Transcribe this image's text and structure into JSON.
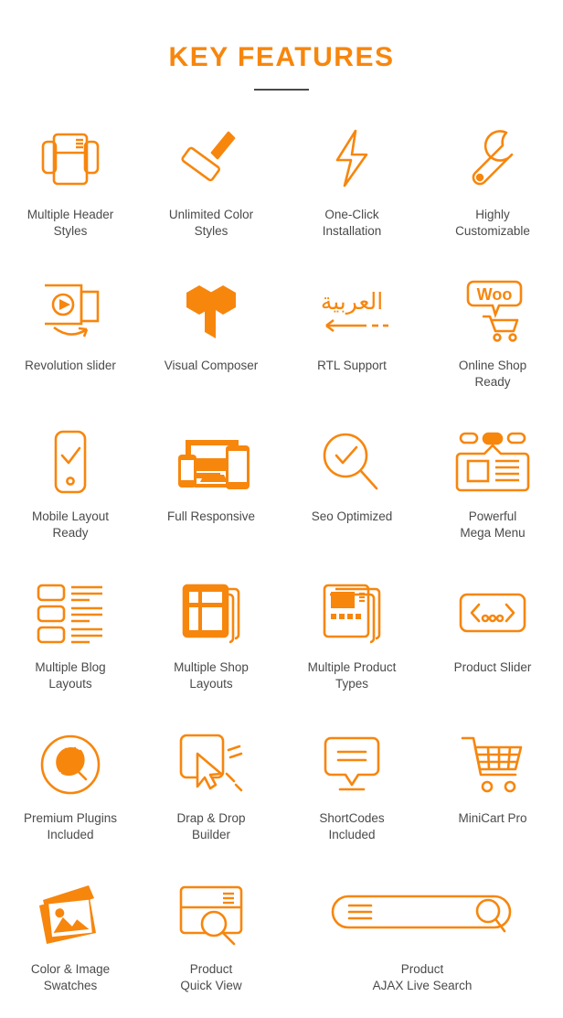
{
  "header": {
    "title": "KEY FEATURES"
  },
  "colors": {
    "accent": "#F7860D",
    "label_text": "#4a4a4a",
    "background": "#ffffff",
    "divider": "#4a4a4a"
  },
  "features": [
    {
      "icon": "multiple-header-styles-icon",
      "label": "Multiple Header\nStyles"
    },
    {
      "icon": "paint-roller-icon",
      "label": "Unlimited Color\nStyles"
    },
    {
      "icon": "lightning-bolt-icon",
      "label": "One-Click\nInstallation"
    },
    {
      "icon": "wrench-icon",
      "label": "Highly\nCustomizable"
    },
    {
      "icon": "revolution-slider-icon",
      "label": "Revolution slider"
    },
    {
      "icon": "visual-composer-logo-icon",
      "label": "Visual Composer"
    },
    {
      "icon": "rtl-arabic-arrow-icon",
      "label": "RTL Support"
    },
    {
      "icon": "woocommerce-cart-icon",
      "label": "Online Shop\nReady"
    },
    {
      "icon": "mobile-check-icon",
      "label": "Mobile Layout\nReady"
    },
    {
      "icon": "responsive-devices-icon",
      "label": "Full Responsive"
    },
    {
      "icon": "magnifier-check-icon",
      "label": "Seo Optimized"
    },
    {
      "icon": "mega-menu-icon",
      "label": "Powerful\nMega Menu"
    },
    {
      "icon": "blog-list-layout-icon",
      "label": "Multiple Blog\nLayouts"
    },
    {
      "icon": "shop-pages-icon",
      "label": "Multiple Shop\nLayouts"
    },
    {
      "icon": "product-types-icon",
      "label": "Multiple Product\nTypes"
    },
    {
      "icon": "slider-arrows-dots-icon",
      "label": "Product Slider"
    },
    {
      "icon": "plug-circle-icon",
      "label": "Premium Plugins\nIncluded"
    },
    {
      "icon": "drag-drop-cursor-icon",
      "label": "Drap & Drop\nBuilder"
    },
    {
      "icon": "shortcode-bubble-icon",
      "label": "ShortCodes\nIncluded"
    },
    {
      "icon": "minicart-icon",
      "label": "MiniCart Pro"
    },
    {
      "icon": "image-swatches-icon",
      "label": "Color & Image\nSwatches"
    },
    {
      "icon": "quick-view-magnifier-icon",
      "label": "Product\nQuick View"
    },
    {
      "icon": "ajax-search-bar-icon",
      "label": "Product\nAJAX Live Search"
    }
  ]
}
